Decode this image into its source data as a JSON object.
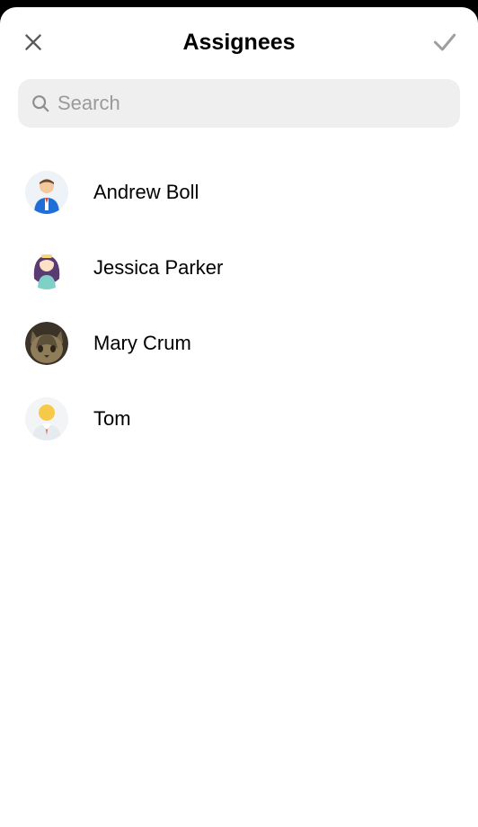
{
  "header": {
    "title": "Assignees"
  },
  "search": {
    "placeholder": "Search",
    "value": ""
  },
  "assignees": [
    {
      "name": "Andrew Boll",
      "avatar_kind": "man-blue"
    },
    {
      "name": "Jessica Parker",
      "avatar_kind": "woman-purple"
    },
    {
      "name": "Mary Crum",
      "avatar_kind": "cat"
    },
    {
      "name": "Tom",
      "avatar_kind": "man-yellow"
    }
  ]
}
